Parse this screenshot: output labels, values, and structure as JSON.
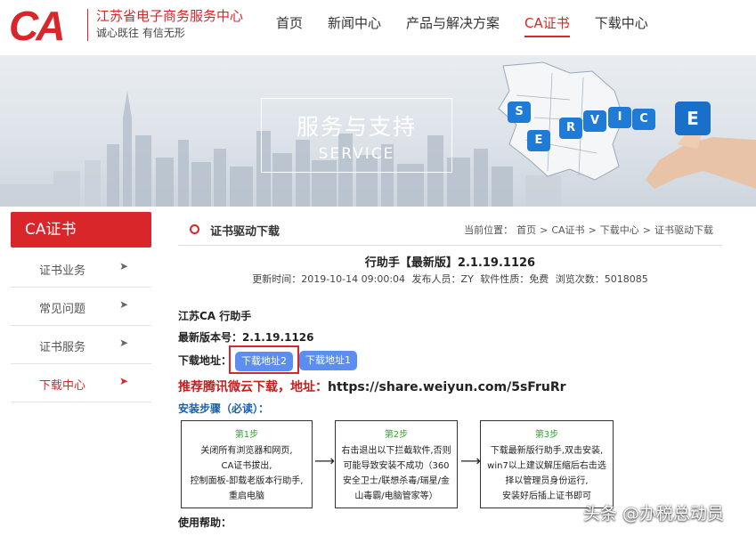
{
  "header": {
    "logo_mark": "CA",
    "logo_name": "江苏省电子商务服务中心",
    "logo_slogan": "诚心既往 有信无形",
    "nav": [
      {
        "label": "首页"
      },
      {
        "label": "新闻中心"
      },
      {
        "label": "产品与解决方案"
      },
      {
        "label": "CA证书"
      },
      {
        "label": "下载中心"
      }
    ]
  },
  "banner": {
    "title": "服务与支持",
    "subtitle": "SERVICE",
    "keys": [
      "S",
      "E",
      "R",
      "V",
      "I",
      "C",
      "E"
    ]
  },
  "sidebar": {
    "title": "CA证书",
    "items": [
      {
        "label": "证书业务",
        "arrow": "➤"
      },
      {
        "label": "常见问题",
        "arrow": "➤"
      },
      {
        "label": "证书服务",
        "arrow": "➤"
      },
      {
        "label": "下载中心",
        "arrow": "➤"
      }
    ]
  },
  "section": {
    "title": "证书驱动下载",
    "breadcrumb": {
      "prefix": "当前位置：",
      "items": [
        "首页",
        "CA证书",
        "下载中心",
        "证书驱动下载"
      ],
      "sep": ">"
    }
  },
  "article": {
    "title": "行助手【最新版】2.1.19.1126",
    "meta": {
      "updated": "更新时间：2019-10-14 09:00:04",
      "publisher": "发布人员：ZY",
      "license": "软件性质：免费",
      "views": "浏览次数：5018085"
    },
    "product": "江苏CA 行助手",
    "version_label": "最新版本号：",
    "version": "2.1.19.1126",
    "download_label": "下载地址：",
    "download_buttons": [
      "下载地址2",
      "下载地址1"
    ],
    "weiyun_label": "推荐腾讯微云下载，地址：",
    "weiyun_url": "https://share.weiyun.com/5sFruRr",
    "steps_title": "安装步骤（必读）：",
    "steps": [
      {
        "num": "第1步",
        "lines": [
          "关闭所有浏览器和网页,",
          "CA证书拔出,",
          "控制面板-卸载老版本行助手,",
          "重启电脑"
        ]
      },
      {
        "num": "第2步",
        "lines": [
          "右击退出以下拦截软件,否则",
          "可能导致安装不成功（360",
          "安全卫士/联想杀毒/瑞星/金",
          "山毒霸/电脑管家等）"
        ]
      },
      {
        "num": "第3步",
        "lines": [
          "下载最新版行助手,双击安装,",
          "win7以上建议解压缩后右击选",
          "择以管理员身份运行,",
          "安装好后插上证书即可"
        ]
      }
    ],
    "step_arrow": "⟶",
    "help_label": "使用帮助："
  },
  "watermark": "头条 @办税总动员",
  "colors": {
    "brand_red": "#d9262a",
    "button_blue": "#5b8ef0",
    "step_green": "#2fa52f",
    "link_blue": "#1a5fa8"
  }
}
